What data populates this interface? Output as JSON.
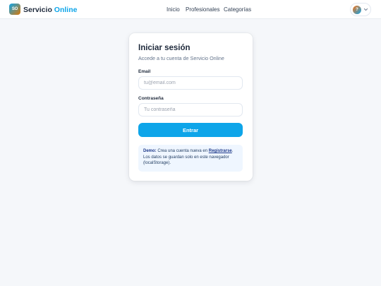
{
  "brand": {
    "logo_initials": "SO",
    "name_part1": "Servicio",
    "name_part2": "Online"
  },
  "nav": {
    "links": [
      "Inicio",
      "Profesionales",
      "Categorías"
    ]
  },
  "user_menu": {
    "avatar_initial": "?"
  },
  "login": {
    "title": "Iniciar sesión",
    "subtitle": "Accede a tu cuenta de Servicio Online",
    "email_label": "Email",
    "email_placeholder": "tu@email.com",
    "email_value": "",
    "password_label": "Contraseña",
    "password_placeholder": "Tu contraseña",
    "password_value": "",
    "submit_label": "Entrar"
  },
  "notice": {
    "prefix": "Demo:",
    "text_before_link": " Crea una cuenta nueva en ",
    "link": "Registrarse",
    "line2": "Los datos se guardan solo en este navegador",
    "line3": "(localStorage)."
  },
  "colors": {
    "accent": "#0ea5e9",
    "background": "#f5f7fa",
    "notice_bg": "#eff6ff"
  }
}
